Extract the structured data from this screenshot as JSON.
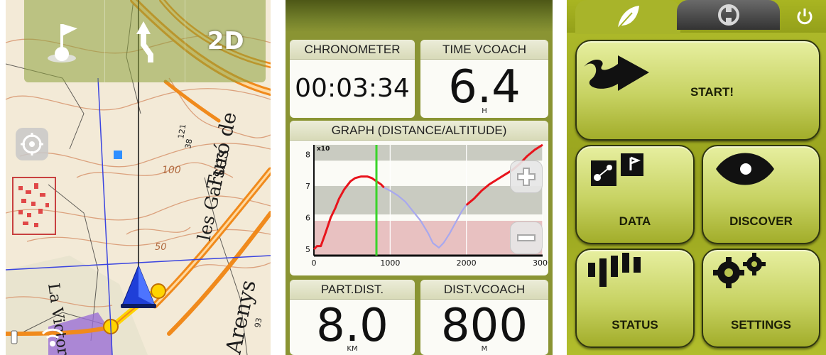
{
  "map": {
    "mode_button": "2D",
    "labels": {
      "turo_de": "Turó de",
      "les_garses": "les Garses",
      "la_victoria": "La Victoria",
      "arenys": "Arenys",
      "contour_100": "100",
      "contour_50": "50",
      "spot_38": "38",
      "spot_121": "121",
      "spot_93": "93"
    },
    "icons": [
      "flag-map-icon",
      "navigation-arrow-icon",
      "gps-target-icon",
      "position-cursor-icon",
      "signal-icon"
    ]
  },
  "dashboard": {
    "chronometer": {
      "title": "CHRONOMETER",
      "value": "00:03:34",
      "unit": ""
    },
    "time_vcoach": {
      "title": "TIME VCOACH",
      "value": "6.4",
      "unit": "H"
    },
    "part_dist": {
      "title": "PART.DIST.",
      "value": "8.0",
      "unit": "KM"
    },
    "dist_vcoach": {
      "title": "DIST.VCOACH",
      "value": "800",
      "unit": "M"
    },
    "graph": {
      "title": "GRAPH (DISTANCE/ALTITUDE)"
    }
  },
  "chart_data": {
    "type": "line",
    "title": "GRAPH (DISTANCE/ALTITUDE)",
    "xlabel": "",
    "ylabel": "",
    "y_multiplier_label": "x10",
    "xlim": [
      0,
      3000
    ],
    "ylim": [
      4.8,
      8.3
    ],
    "x_ticks": [
      0,
      1000,
      2000,
      3000
    ],
    "y_ticks": [
      5,
      6,
      7,
      8
    ],
    "current_position_x": 820,
    "series": [
      {
        "kind": "traveled",
        "color": "#e8141c",
        "x": [
          0,
          40,
          90,
          150,
          220,
          280,
          330,
          400,
          480,
          540,
          620,
          700,
          760,
          820,
          880,
          920
        ],
        "y": [
          5.0,
          5.1,
          5.1,
          5.5,
          6.0,
          6.3,
          6.6,
          6.9,
          7.15,
          7.25,
          7.3,
          7.3,
          7.25,
          7.15,
          7.05,
          6.95
        ]
      },
      {
        "kind": "remaining",
        "color": "#a8a8ee",
        "x": [
          920,
          1000,
          1100,
          1200,
          1300,
          1400,
          1500,
          1560,
          1640,
          1700,
          1780,
          1860,
          1940,
          2000
        ],
        "y": [
          6.95,
          6.85,
          6.7,
          6.5,
          6.2,
          5.9,
          5.5,
          5.2,
          5.05,
          5.2,
          5.5,
          5.85,
          6.2,
          6.4
        ]
      },
      {
        "kind": "traveled",
        "color": "#e8141c",
        "x": [
          2000,
          2100,
          2200,
          2300,
          2400,
          2500,
          2600,
          2700,
          2800,
          2900,
          3000
        ],
        "y": [
          6.4,
          6.6,
          6.85,
          7.05,
          7.2,
          7.35,
          7.5,
          7.7,
          7.95,
          8.15,
          8.3
        ]
      }
    ],
    "bands": [
      {
        "from": 7.8,
        "to": 8.3,
        "color": "#c9cbc1"
      },
      {
        "from": 6.1,
        "to": 7.0,
        "color": "#c9cbc1"
      },
      {
        "from": 4.8,
        "to": 5.9,
        "color": "#e8c1c1"
      }
    ]
  },
  "menu": {
    "tabs": [
      "eco-leaf-icon",
      "dashboard-icon",
      "power-icon"
    ],
    "start": "START!",
    "data": "DATA",
    "discover": "DISCOVER",
    "status": "STATUS",
    "settings": "SETTINGS"
  }
}
